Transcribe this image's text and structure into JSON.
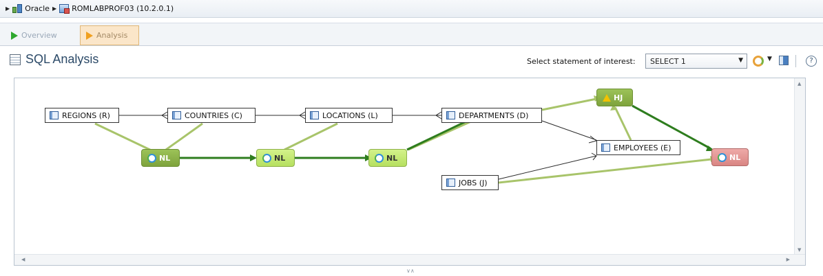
{
  "breadcrumb": {
    "items": [
      {
        "label": "Oracle",
        "icon": "database-icon"
      },
      {
        "label": "ROMLABPROF03 (10.2.0.1)",
        "icon": "instance-icon"
      }
    ]
  },
  "tabs": [
    {
      "label": "Overview",
      "icon": "play-green-icon",
      "active": false
    },
    {
      "label": "Analysis",
      "icon": "play-orange-icon",
      "active": true
    }
  ],
  "header": {
    "title": "SQL Analysis",
    "statement_label": "Select statement of interest:",
    "statement_value": "SELECT 1"
  },
  "graph": {
    "tables": {
      "regions": "REGIONS (R)",
      "countries": "COUNTRIES (C)",
      "locations": "LOCATIONS (L)",
      "departments": "DEPARTMENTS (D)",
      "employees": "EMPLOYEES (E)",
      "jobs": "JOBS (J)"
    },
    "operators": {
      "nl1": "NL",
      "nl2": "NL",
      "nl3": "NL",
      "hj": "HJ",
      "nl4": "NL"
    }
  },
  "colors": {
    "accent": "#2c4a68",
    "flow_dark": "#2e7d1e",
    "flow_light": "#a8c46a",
    "node_red": "#d98583"
  }
}
